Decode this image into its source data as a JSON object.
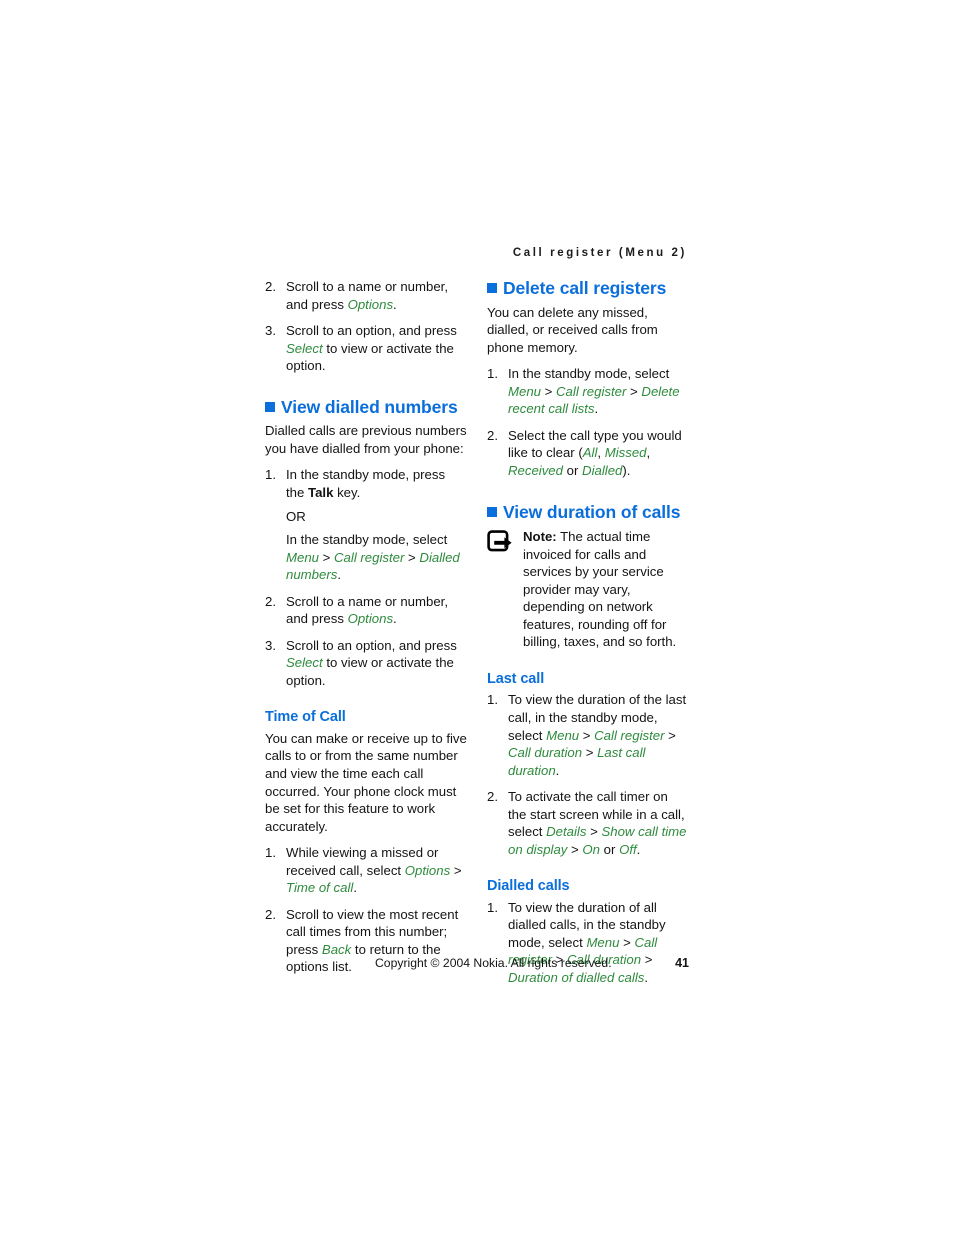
{
  "header": {
    "running_title": "Call register (Menu 2)"
  },
  "left_column": {
    "continued_steps": [
      {
        "num": "2.",
        "parts": [
          {
            "t": "Scroll to a name or number, and press ",
            "s": "plain"
          },
          {
            "t": "Options",
            "s": "ui"
          },
          {
            "t": ".",
            "s": "plain"
          }
        ]
      },
      {
        "num": "3.",
        "parts": [
          {
            "t": "Scroll to an option, and press ",
            "s": "plain"
          },
          {
            "t": "Select",
            "s": "ui"
          },
          {
            "t": " to view or activate the option.",
            "s": "plain"
          }
        ]
      }
    ],
    "section_view_dialled": {
      "heading": "View dialled numbers",
      "intro": "Dialled calls are previous numbers you have dialled from your phone:",
      "steps": [
        {
          "num": "1.",
          "parts": [
            {
              "t": "In the standby mode, press the ",
              "s": "plain"
            },
            {
              "t": "Talk",
              "s": "bold"
            },
            {
              "t": " key.",
              "s": "plain"
            }
          ],
          "or_label": "OR",
          "alt_parts": [
            {
              "t": "In the standby mode, select ",
              "s": "plain"
            },
            {
              "t": "Menu",
              "s": "ui"
            },
            {
              "t": " > ",
              "s": "plain"
            },
            {
              "t": "Call register",
              "s": "ui"
            },
            {
              "t": " > ",
              "s": "plain"
            },
            {
              "t": "Dialled numbers",
              "s": "ui"
            },
            {
              "t": ".",
              "s": "plain"
            }
          ]
        },
        {
          "num": "2.",
          "parts": [
            {
              "t": "Scroll to a name or number, and press ",
              "s": "plain"
            },
            {
              "t": "Options",
              "s": "ui"
            },
            {
              "t": ".",
              "s": "plain"
            }
          ]
        },
        {
          "num": "3.",
          "parts": [
            {
              "t": "Scroll to an option, and press ",
              "s": "plain"
            },
            {
              "t": "Select",
              "s": "ui"
            },
            {
              "t": " to view or activate the option.",
              "s": "plain"
            }
          ]
        }
      ]
    },
    "section_time_of_call": {
      "heading": "Time of Call",
      "intro": "You can make or receive up to five calls to or from the same number and view the time each call occurred. Your phone clock must be set for this feature to work accurately.",
      "steps": [
        {
          "num": "1.",
          "parts": [
            {
              "t": "While viewing a missed or received call, select ",
              "s": "plain"
            },
            {
              "t": "Options",
              "s": "ui"
            },
            {
              "t": " > ",
              "s": "plain"
            },
            {
              "t": "Time of call",
              "s": "ui"
            },
            {
              "t": ".",
              "s": "plain"
            }
          ]
        },
        {
          "num": "2.",
          "parts": [
            {
              "t": "Scroll to view the most recent call times from this number; press ",
              "s": "plain"
            },
            {
              "t": "Back",
              "s": "ui"
            },
            {
              "t": " to return to the options list.",
              "s": "plain"
            }
          ]
        }
      ]
    }
  },
  "right_column": {
    "section_delete": {
      "heading": "Delete call registers",
      "intro": "You can delete any missed, dialled, or received calls from phone memory.",
      "steps": [
        {
          "num": "1.",
          "parts": [
            {
              "t": "In the standby mode, select ",
              "s": "plain"
            },
            {
              "t": "Menu",
              "s": "ui"
            },
            {
              "t": " > ",
              "s": "plain"
            },
            {
              "t": "Call register",
              "s": "ui"
            },
            {
              "t": " > ",
              "s": "plain"
            },
            {
              "t": "Delete recent call lists",
              "s": "ui"
            },
            {
              "t": ".",
              "s": "plain"
            }
          ]
        },
        {
          "num": "2.",
          "parts": [
            {
              "t": "Select the call type you would like to clear (",
              "s": "plain"
            },
            {
              "t": "All",
              "s": "ui"
            },
            {
              "t": ", ",
              "s": "plain"
            },
            {
              "t": "Missed",
              "s": "ui"
            },
            {
              "t": ", ",
              "s": "plain"
            },
            {
              "t": "Received",
              "s": "ui"
            },
            {
              "t": " or ",
              "s": "plain"
            },
            {
              "t": "Dialled",
              "s": "ui"
            },
            {
              "t": ").",
              "s": "plain"
            }
          ]
        }
      ]
    },
    "section_duration": {
      "heading": "View duration of calls",
      "note": {
        "icon": "note-pointer-icon",
        "label": "Note:",
        "text": " The actual time invoiced for calls and services by your service provider may vary, depending on network features, rounding off for billing, taxes, and so forth."
      },
      "sub_last_call": {
        "heading": "Last call",
        "steps": [
          {
            "num": "1.",
            "parts": [
              {
                "t": "To view the duration of the last call, in the standby mode, select ",
                "s": "plain"
              },
              {
                "t": "Menu",
                "s": "ui"
              },
              {
                "t": " > ",
                "s": "plain"
              },
              {
                "t": "Call register",
                "s": "ui"
              },
              {
                "t": " > ",
                "s": "plain"
              },
              {
                "t": "Call duration",
                "s": "ui"
              },
              {
                "t": " > ",
                "s": "plain"
              },
              {
                "t": "Last call duration",
                "s": "ui"
              },
              {
                "t": ".",
                "s": "plain"
              }
            ]
          },
          {
            "num": "2.",
            "parts": [
              {
                "t": "To activate the call timer on the start screen while in a call, select ",
                "s": "plain"
              },
              {
                "t": "Details",
                "s": "ui"
              },
              {
                "t": " > ",
                "s": "plain"
              },
              {
                "t": "Show call time on display",
                "s": "ui"
              },
              {
                "t": " > ",
                "s": "plain"
              },
              {
                "t": "On",
                "s": "ui"
              },
              {
                "t": " or ",
                "s": "plain"
              },
              {
                "t": "Off",
                "s": "ui"
              },
              {
                "t": ".",
                "s": "plain"
              }
            ]
          }
        ]
      },
      "sub_dialled_calls": {
        "heading": "Dialled calls",
        "steps": [
          {
            "num": "1.",
            "parts": [
              {
                "t": "To view the duration of all dialled calls, in the standby mode, select ",
                "s": "plain"
              },
              {
                "t": "Menu",
                "s": "ui"
              },
              {
                "t": " > ",
                "s": "plain"
              },
              {
                "t": "Call register",
                "s": "ui"
              },
              {
                "t": " > ",
                "s": "plain"
              },
              {
                "t": "Call duration",
                "s": "ui"
              },
              {
                "t": " > ",
                "s": "plain"
              },
              {
                "t": "Duration of dialled calls",
                "s": "ui"
              },
              {
                "t": ".",
                "s": "plain"
              }
            ]
          }
        ]
      }
    }
  },
  "footer": {
    "copyright": "Copyright © 2004 Nokia. All rights reserved.",
    "page_number": "41"
  },
  "colors": {
    "heading_blue": "#0a6edb",
    "ui_green": "#2e8b3d",
    "body_black": "#141414"
  }
}
